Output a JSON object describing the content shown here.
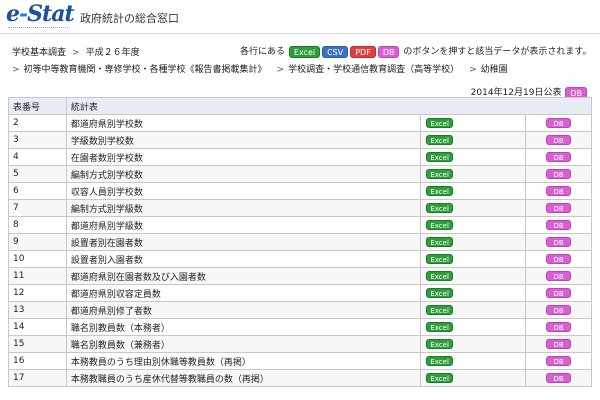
{
  "header": {
    "logo_e": "e",
    "logo_dash": "-",
    "logo_stat": "Stat",
    "title": "政府統計の総合窓口"
  },
  "breadcrumb": {
    "survey": "学校基本調査",
    "year": "平成２６年度",
    "level2": "初等中等教育機関・専修学校・各種学校《報告書掲載集計》",
    "level3": "学校調査・学校通信教育調査（高等学校）",
    "level4": "幼稚園"
  },
  "hint": {
    "prefix": "各行にある",
    "excel": "Excel",
    "csv": "CSV",
    "pdf": "PDF",
    "db": "DB",
    "suffix": "のボタンを押すと該当データが表示されます。"
  },
  "announce": {
    "date": "2014年12月19日公表",
    "db": "DB"
  },
  "table": {
    "col_no": "表番号",
    "col_title": "統計表",
    "excel_label": "Excel",
    "db_label": "DB",
    "rows": [
      {
        "no": "2",
        "title": "都道府県別学校数"
      },
      {
        "no": "3",
        "title": "学級数別学校数"
      },
      {
        "no": "4",
        "title": "在園者数別学校数"
      },
      {
        "no": "5",
        "title": "編制方式別学校数"
      },
      {
        "no": "6",
        "title": "収容人員別学校数"
      },
      {
        "no": "7",
        "title": "編制方式別学級数"
      },
      {
        "no": "8",
        "title": "都道府県別学級数"
      },
      {
        "no": "9",
        "title": "設置者別在園者数"
      },
      {
        "no": "10",
        "title": "設置者別入園者数"
      },
      {
        "no": "11",
        "title": "都道府県別在園者数及び入園者数"
      },
      {
        "no": "12",
        "title": "都道府県別収容定員数"
      },
      {
        "no": "13",
        "title": "都道府県別修了者数"
      },
      {
        "no": "14",
        "title": "職名別教員数（本務者）"
      },
      {
        "no": "15",
        "title": "職名別教員数（兼務者）"
      },
      {
        "no": "16",
        "title": "本務教員のうち理由別休職等教員数（再掲）"
      },
      {
        "no": "17",
        "title": "本務教職員のうち産休代替等教職員の数（再掲）"
      }
    ]
  }
}
